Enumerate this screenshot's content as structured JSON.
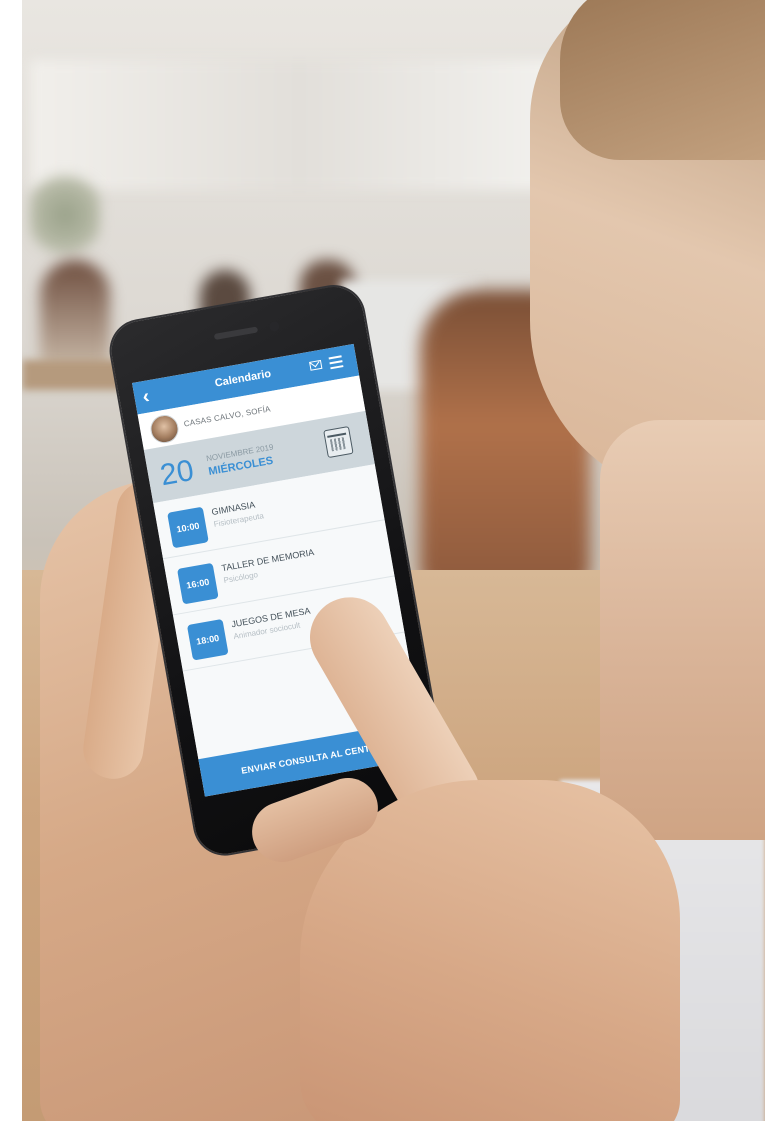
{
  "app": {
    "header_title": "Calendario",
    "back_icon": "chevron-left-icon",
    "mail_icon": "mail-icon",
    "menu_icon": "hamburger-menu-icon"
  },
  "user": {
    "name": "CASAS CALVO, SOFÍA"
  },
  "date": {
    "day": "20",
    "month_year": "NOVIEMBRE 2019",
    "weekday": "MIÉRCOLES",
    "icon": "calendar-icon"
  },
  "events": [
    {
      "time": "10:00",
      "title": "GIMNASIA",
      "subtitle": "Fisioterapeuta"
    },
    {
      "time": "16:00",
      "title": "TALLER DE MEMORIA",
      "subtitle": "Psicólogo"
    },
    {
      "time": "18:00",
      "title": "JUEGOS DE MESA",
      "subtitle": "Animador sociocult"
    }
  ],
  "send_button": "ENVIAR CONSULTA AL CENTRO",
  "colors": {
    "accent": "#3a8fd4",
    "banner": "#cdd6db",
    "screen_bg": "#f3f6f8"
  }
}
